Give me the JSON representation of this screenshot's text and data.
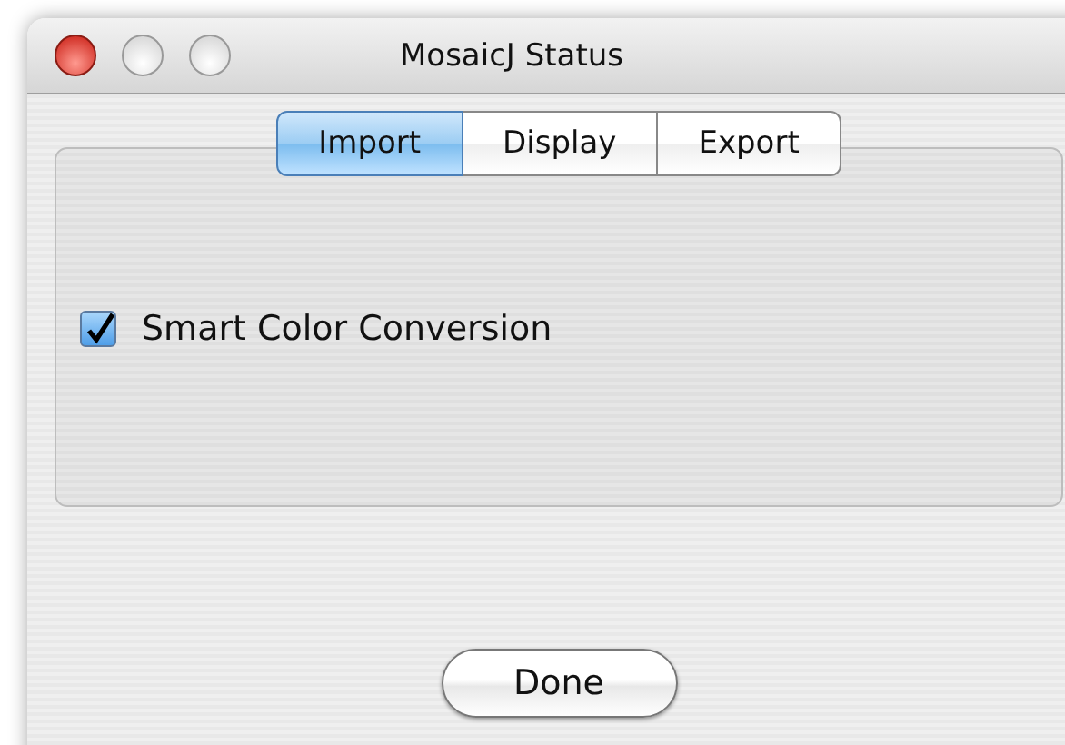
{
  "window": {
    "title": "MosaicJ Status"
  },
  "tabs": [
    {
      "label": "Import",
      "selected": true
    },
    {
      "label": "Display",
      "selected": false
    },
    {
      "label": "Export",
      "selected": false
    }
  ],
  "options": [
    {
      "label": "Smart Color Conversion",
      "checked": true
    }
  ],
  "buttons": [
    {
      "label": "Done"
    }
  ]
}
